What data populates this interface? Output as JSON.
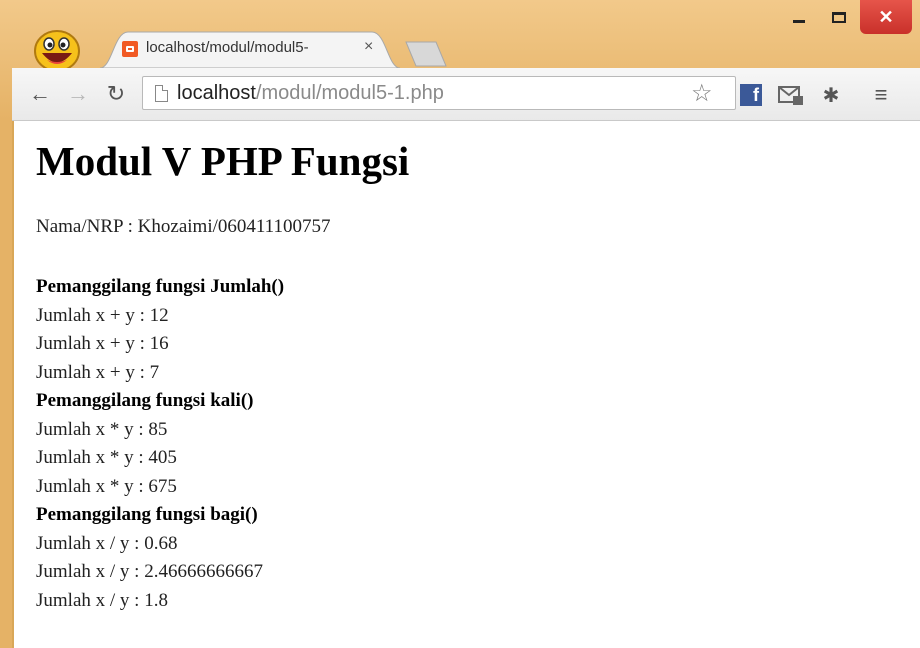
{
  "browser": {
    "tab_title": "localhost/modul/modul5-",
    "tab_close": "×",
    "url_host": "localhost",
    "url_path": "/modul/modul5-1.php",
    "colors": {
      "tab_favicon": "#f15a24",
      "close_button": "#d9433a",
      "window_frame": "#e8b96f"
    }
  },
  "page": {
    "title": "Modul V PHP Fungsi",
    "nrp": "Nama/NRP : Khozaimi/060411100757",
    "lines": [
      {
        "text": "Pemanggilang fungsi Jumlah()",
        "heading": true
      },
      {
        "text": "Jumlah x + y : 12",
        "heading": false
      },
      {
        "text": "Jumlah x + y : 16",
        "heading": false
      },
      {
        "text": "Jumlah x + y : 7",
        "heading": false
      },
      {
        "text": "Pemanggilang fungsi kali()",
        "heading": true
      },
      {
        "text": "Jumlah x * y : 85",
        "heading": false
      },
      {
        "text": "Jumlah x * y : 405",
        "heading": false
      },
      {
        "text": "Jumlah x * y : 675",
        "heading": false
      },
      {
        "text": "Pemanggilang fungsi bagi()",
        "heading": true
      },
      {
        "text": "Jumlah x / y : 0.68",
        "heading": false
      },
      {
        "text": "Jumlah x / y : 2.46666666667",
        "heading": false
      },
      {
        "text": "Jumlah x / y : 1.8",
        "heading": false
      }
    ]
  }
}
